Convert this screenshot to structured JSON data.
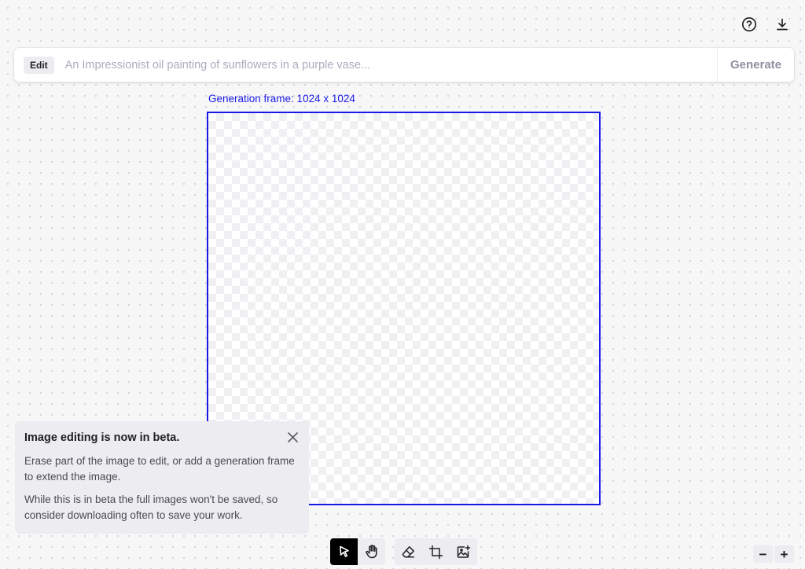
{
  "header": {
    "icons": [
      "help-circle-icon",
      "download-icon"
    ]
  },
  "prompt": {
    "mode_badge": "Edit",
    "placeholder": "An Impressionist oil painting of sunflowers in a purple vase...",
    "value": "",
    "generate_label": "Generate"
  },
  "canvas": {
    "frame_label": "Generation frame: 1024 x 1024"
  },
  "toast": {
    "title": "Image editing is now in beta.",
    "paragraph1": "Erase part of the image to edit, or add a generation frame to extend the image.",
    "paragraph2": "While this is in beta the full images won't be saved, so consider downloading often to save your work."
  },
  "toolbar": {
    "selected_tool": "select",
    "tools": [
      "select-tool-icon",
      "hand-tool-icon",
      "eraser-tool-icon",
      "add-frame-tool-icon",
      "upload-image-tool-icon"
    ]
  },
  "zoom": {
    "out_label": "−",
    "in_label": "+"
  },
  "colors": {
    "frame_accent": "#1a1ae6",
    "background": "#f7f7f8",
    "panel": "#ececf1"
  }
}
